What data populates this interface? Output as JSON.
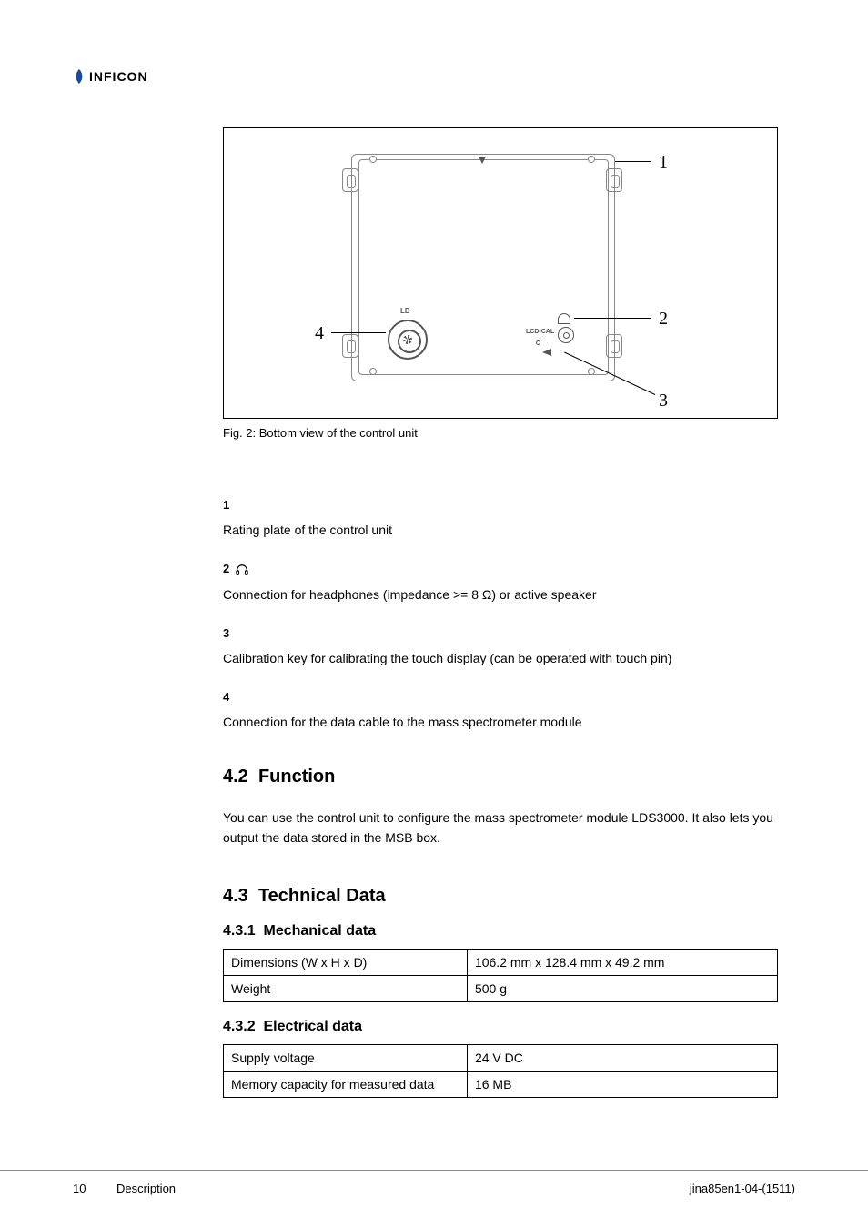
{
  "brand": {
    "name": "INFICON"
  },
  "figure": {
    "caption": "Fig. 2: Bottom view of the control unit",
    "ld_label": "LD",
    "lcdcal_label": "LCD-CAL",
    "callouts": {
      "c1": "1",
      "c2": "2",
      "c3": "3",
      "c4": "4"
    }
  },
  "list": [
    {
      "num": "1",
      "desc": "Rating plate of the control unit"
    },
    {
      "num": "2",
      "desc": "Connection for headphones (impedance >= 8 Ω) or active speaker",
      "has_headphone_icon": true
    },
    {
      "num": "3",
      "desc": "Calibration key for calibrating the touch display (can be operated with touch pin)"
    },
    {
      "num": "4",
      "desc": "Connection for the data cable to the mass spectrometer module"
    }
  ],
  "section_function": {
    "number": "4.2",
    "title": "Function",
    "text": "You can use the control unit to configure the mass spectrometer module LDS3000. It also lets you output the data stored in the MSB box."
  },
  "section_techdata": {
    "number": "4.3",
    "title": "Technical Data",
    "sub_mech": {
      "number": "4.3.1",
      "title": "Mechanical data"
    },
    "sub_elec": {
      "number": "4.3.2",
      "title": "Electrical data"
    },
    "table_mech": [
      {
        "label": "Dimensions (W x H x D)",
        "value": "106.2 mm x 128.4 mm x 49.2 mm"
      },
      {
        "label": "Weight",
        "value": "500 g"
      }
    ],
    "table_elec": [
      {
        "label": "Supply voltage",
        "value": "24 V DC"
      },
      {
        "label": "Memory capacity for measured data",
        "value": "16 MB"
      }
    ]
  },
  "footer": {
    "page": "10",
    "section": "Description",
    "docid": "jina85en1-04-(1511)"
  }
}
